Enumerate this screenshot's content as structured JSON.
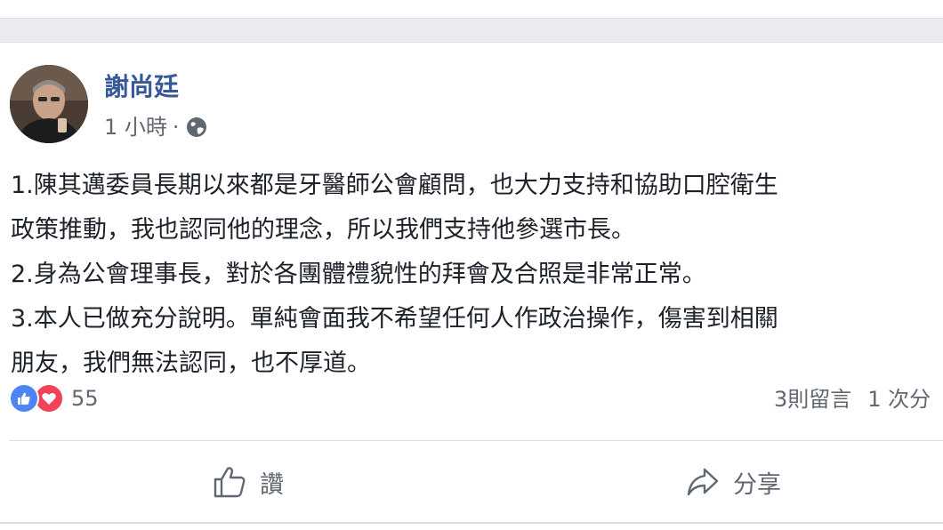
{
  "post": {
    "author": "謝尚廷",
    "time": "1 小時",
    "separator": "·",
    "privacy_icon": "globe-icon",
    "paragraphs": [
      "1.陳其邁委員長期以來都是牙醫師公會顧問，也大力支持和協助口腔衛生",
      "政策推動，我也認同他的理念，所以我們支持他參選市長。",
      "2.身為公會理事長，對於各團體禮貌性的拜會及合照是非常正常。",
      "3.本人已做充分說明。單純會面我不希望任何人作政治操作，傷害到相關",
      "朋友，我們無法認同，也不厚道。"
    ],
    "reactions": {
      "icons": [
        "like-reaction-icon",
        "love-reaction-icon"
      ],
      "count": "55"
    },
    "stats": {
      "comments": "3則留言",
      "shares": "1 次分"
    },
    "actions": {
      "like": "讚",
      "share": "分享"
    }
  },
  "colors": {
    "author": "#365899",
    "meta": "#616770",
    "feed_background": "#e9ebee",
    "like": "#4f84f4",
    "love": "#f0435a"
  }
}
